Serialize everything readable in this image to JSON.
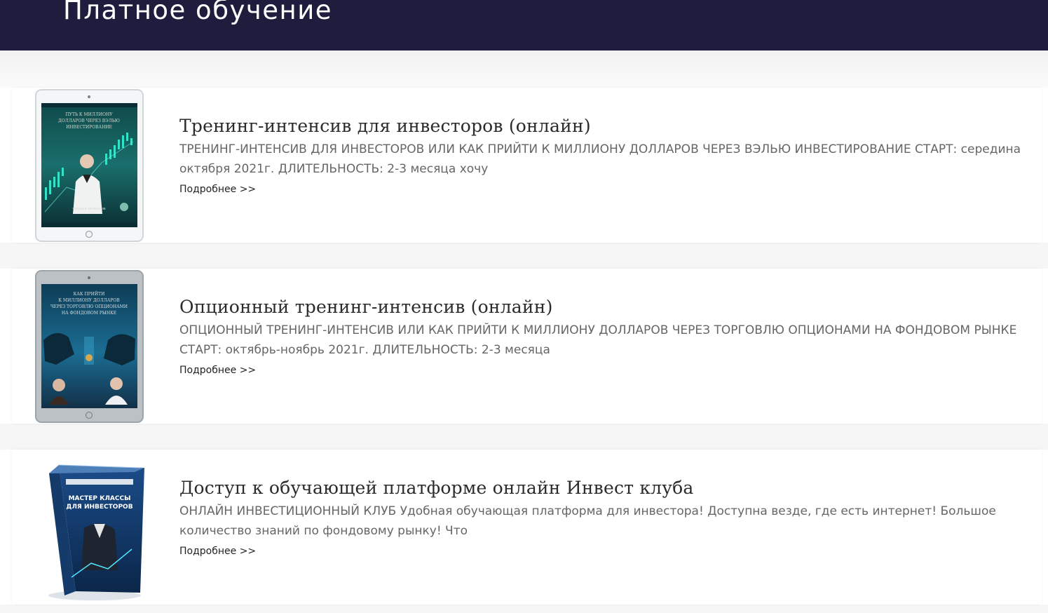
{
  "header": {
    "title": "Платное обучение",
    "background": "#1f1d3d"
  },
  "courses": [
    {
      "title": "Тренинг-интенсив для инвесторов (онлайн)",
      "description": "ТРЕНИНГ-ИНТЕНСИВ ДЛЯ ИНВЕСТОРОВ ИЛИ КАК ПРИЙТИ К МИЛЛИОНУ ДОЛЛАРОВ ЧЕРЕЗ ВЭЛЬЮ ИНВЕСТИРОВАНИЕ СТАРТ: середина октября 2021г. ДЛИТЕЛЬНОСТЬ: 2-3 месяца хочу",
      "link": "Подробнее >>",
      "image_icon": "tablet-course-cover-icon"
    },
    {
      "title": "Опционный тренинг-интенсив (онлайн)",
      "description": "ОПЦИОННЫЙ ТРЕНИНГ-ИНТЕНСИВ ИЛИ КАК ПРИЙТИ К МИЛЛИОНУ ДОЛЛАРОВ ЧЕРЕЗ ТОРГОВЛЮ ОПЦИОНАМИ НА ФОНДОВОМ РЫНКЕ СТАРТ: октябрь-ноябрь 2021г. ДЛИТЕЛЬНОСТЬ: 2-3 месяца",
      "link": "Подробнее >>",
      "image_icon": "tablet-course-cover-icon"
    },
    {
      "title": "Доступ к обучающей платформе онлайн Инвест клуба",
      "description": "ОНЛАЙН ИНВЕСТИЦИОННЫЙ КЛУБ Удобная обучающая платформа для инвестора! Доступна везде, где есть интернет! Большое количество знаний по фондовому рынку! Что",
      "link": "Подробнее >>",
      "image_icon": "product-box-icon"
    }
  ]
}
